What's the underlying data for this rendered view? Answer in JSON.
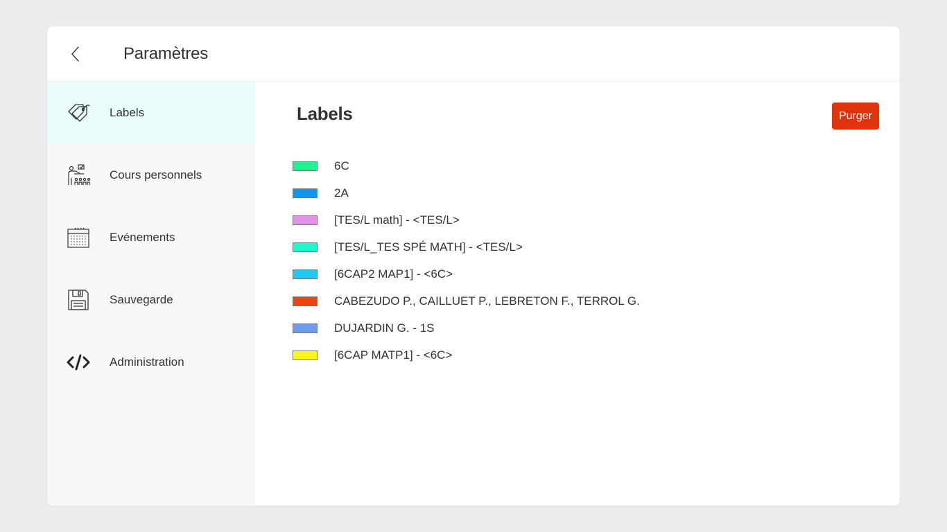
{
  "header": {
    "title": "Paramètres"
  },
  "sidebar": {
    "items": [
      {
        "label": "Labels",
        "icon": "tags-icon",
        "active": true
      },
      {
        "label": "Cours personnels",
        "icon": "teacher-icon",
        "active": false
      },
      {
        "label": "Evénements",
        "icon": "calendar-icon",
        "active": false
      },
      {
        "label": "Sauvegarde",
        "icon": "floppy-disk-icon",
        "active": false
      },
      {
        "label": "Administration",
        "icon": "code-icon",
        "active": false
      }
    ]
  },
  "main": {
    "title": "Labels",
    "purge_label": "Purger",
    "purge_color": "#e0330c",
    "labels": [
      {
        "text": "6C",
        "color": "#1ef391"
      },
      {
        "text": "2A",
        "color": "#1196f2"
      },
      {
        "text": "[TES/L math] - <TES/L>",
        "color": "#e393e7"
      },
      {
        "text": "[TES/L_TES SPÉ MATH] - <TES/L>",
        "color": "#1ef7c9"
      },
      {
        "text": "[6CAP2 MAP1] - <6C>",
        "color": "#1ec8f2"
      },
      {
        "text": "CABEZUDO P., CAILLUET P., LEBRETON F., TERROL G.",
        "color": "#ee4411"
      },
      {
        "text": "DUJARDIN G. - 1S",
        "color": "#6c9cee"
      },
      {
        "text": "[6CAP MATP1] - <6C>",
        "color": "#fbf712"
      }
    ]
  },
  "colors": {
    "active_item_bg": "#e8fcfc",
    "sidebar_bg": "#f8f8f8",
    "page_bg": "#ececec"
  }
}
